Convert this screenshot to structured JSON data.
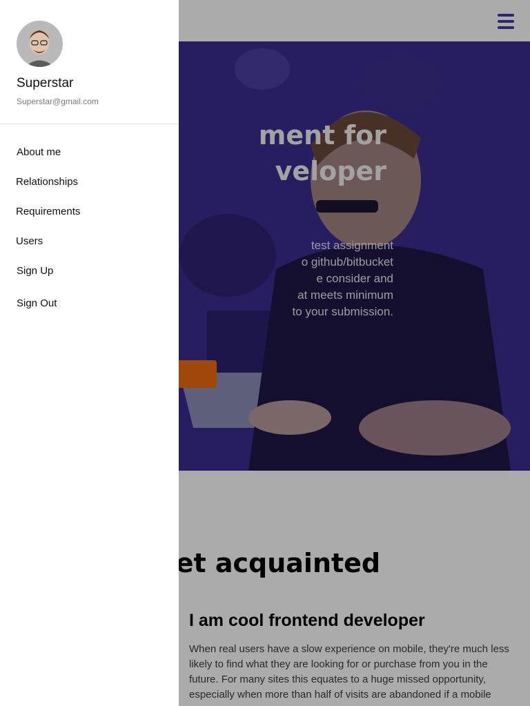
{
  "hero": {
    "title": "ment for\nveloper",
    "text": "test assignment\no github/bitbucket\ne consider and\nat meets minimum\nto your submission."
  },
  "section": {
    "title": "'s get acquainted",
    "subtitle": "I am cool frontend developer",
    "text": "When real users have a slow experience on mobile, they're much less likely to find what they are looking for or purchase from you in the future. For many sites this equates to a huge missed opportunity, especially when more than half of visits are abandoned if a mobile"
  },
  "drawer": {
    "user": {
      "name": "Superstar",
      "email": "Superstar@gmail.com"
    },
    "menu": [
      "About me",
      "Relationships",
      "Requirements",
      "Users",
      "Sign Up",
      "Sign Out"
    ]
  },
  "icons": {
    "menu": "hamburger-menu-icon",
    "avatar": "user-avatar"
  },
  "colors": {
    "accent": "#3f3aa6",
    "button": "#f26b11",
    "hero_overlay": "#2a1f6e"
  }
}
